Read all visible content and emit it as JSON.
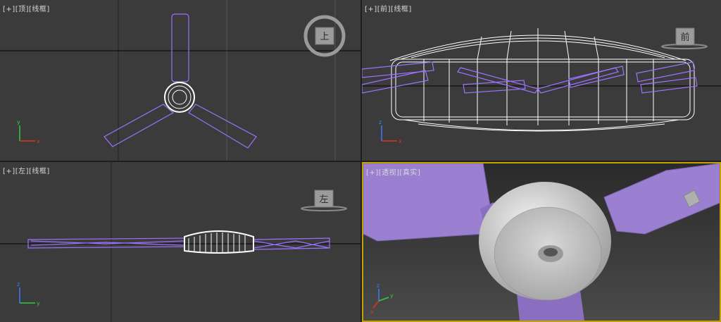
{
  "viewports": {
    "top": {
      "plus": "[+]",
      "view": "[顶]",
      "shading": "[线框]",
      "viewcube": "上"
    },
    "front": {
      "plus": "[+]",
      "view": "[前]",
      "shading": "[线框]",
      "viewcube": "前"
    },
    "left": {
      "plus": "[+]",
      "view": "[左]",
      "shading": "[线框]",
      "viewcube": "左"
    },
    "perspective": {
      "plus": "[+]",
      "view": "[透视]",
      "shading": "[真实]",
      "active": true
    }
  },
  "axis_labels": {
    "x": "x",
    "y": "y",
    "z": "z"
  },
  "colors": {
    "viewport_bg": "#3b3b3b",
    "grid_line": "#1a1a1a",
    "blade_wire": "#9b72ff",
    "motor_wire": "#ffffff",
    "active_border": "#c8a100",
    "blade_shaded": "#9b7fd0"
  }
}
